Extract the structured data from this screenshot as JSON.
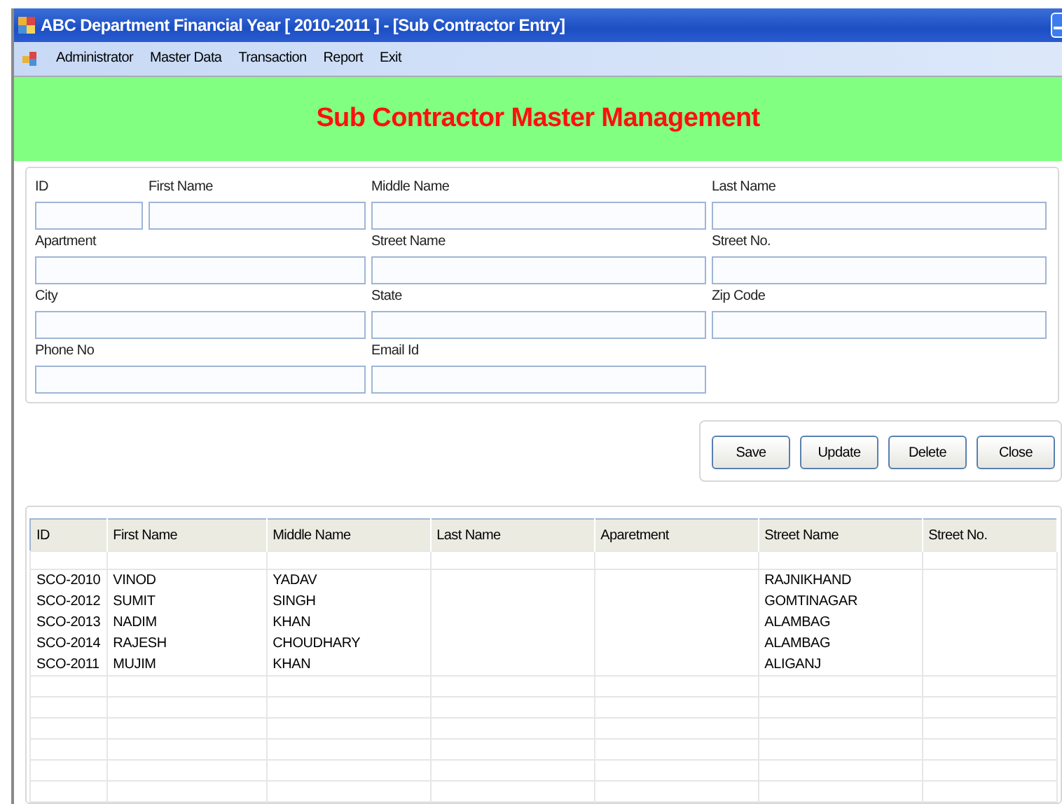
{
  "window": {
    "title": "ABC Department Financial Year [ 2010-2011 ] - [Sub Contractor Entry]"
  },
  "menu": [
    "Administrator",
    "Master Data",
    "Transaction",
    "Report",
    "Exit"
  ],
  "banner": "Sub Contractor Master Management",
  "form_rows": [
    [
      {
        "label": "ID",
        "kind": "short"
      },
      {
        "label": "First Name",
        "kind": "medium"
      },
      {
        "label": "Middle Name",
        "kind": "wide"
      },
      {
        "label": "Last Name",
        "kind": "wide"
      }
    ],
    [
      {
        "label": "Apartment",
        "kind": "wide"
      },
      {
        "label": "Street Name",
        "kind": "wide"
      },
      {
        "label": "Street No.",
        "kind": "wide"
      }
    ],
    [
      {
        "label": "City",
        "kind": "wide"
      },
      {
        "label": "State",
        "kind": "wide"
      },
      {
        "label": "Zip Code",
        "kind": "wide"
      }
    ],
    [
      {
        "label": "Phone No",
        "kind": "wide"
      },
      {
        "label": "Email Id",
        "kind": "wide"
      }
    ]
  ],
  "buttons": [
    "Save",
    "Update",
    "Delete",
    "Close"
  ],
  "table": {
    "columns": [
      "ID",
      "First Name",
      "Middle Name",
      "Last Name",
      "Aparetment",
      "Street Name",
      "Street No."
    ],
    "rows": [
      [
        "SCO-2010",
        "VINOD",
        "YADAV",
        "",
        "",
        "RAJNIKHAND",
        ""
      ],
      [
        "SCO-2012",
        "SUMIT",
        "SINGH",
        "",
        "",
        "GOMTINAGAR",
        ""
      ],
      [
        "SCO-2013",
        "NADIM",
        "KHAN",
        "",
        "",
        "ALAMBAG",
        ""
      ],
      [
        "SCO-2014",
        "RAJESH",
        "CHOUDHARY",
        "",
        "",
        "ALAMBAG",
        ""
      ],
      [
        "SCO-2011",
        "MUJIM",
        "KHAN",
        "",
        "",
        "ALIGANJ",
        ""
      ]
    ]
  }
}
